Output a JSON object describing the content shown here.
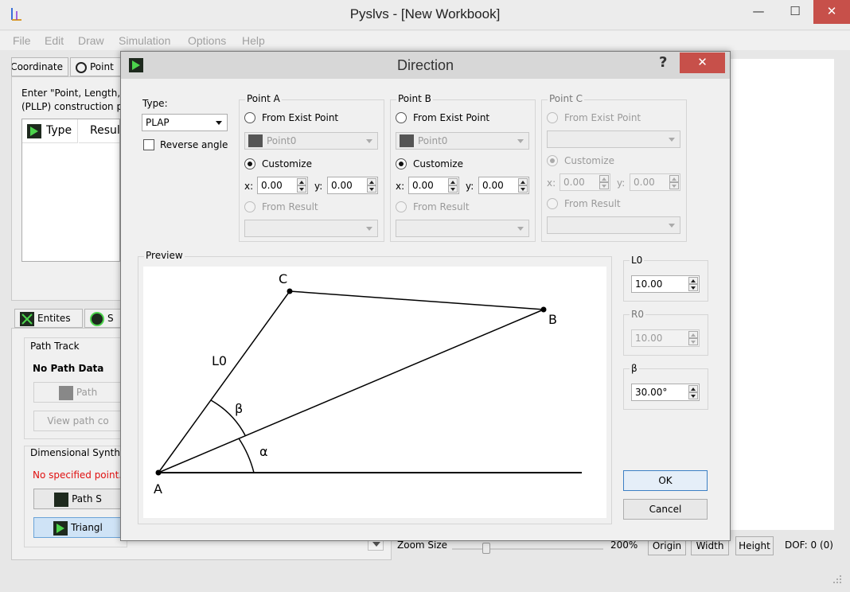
{
  "app": {
    "title": "Pyslvs - [New Workbook]"
  },
  "menu": [
    "File",
    "Edit",
    "Draw",
    "Simulation",
    "Options",
    "Help"
  ],
  "left_panel": {
    "tabs": [
      "Coordinate",
      "Point"
    ],
    "instruction_line1": "Enter \"Point, Length, A",
    "instruction_line2": "(PLLP) construction po",
    "table_headers": [
      "Type",
      "Result"
    ],
    "lower_tabs": [
      "Entites",
      "S"
    ],
    "path_track": {
      "title": "Path Track",
      "status": "No Path Data",
      "path_button": "Path",
      "view_button": "View path co"
    },
    "dimensional": {
      "title": "Dimensional Synthe",
      "error": "No specified point.",
      "path_button": "Path S",
      "triangle_button": "Triangl"
    }
  },
  "bottom_bar": {
    "zoom_label": "Zoom Size",
    "zoom_value": "200%",
    "buttons": [
      "Origin",
      "Width",
      "Height"
    ],
    "dof": "DOF: 0 (0)"
  },
  "dialog": {
    "title": "Direction",
    "help_icon": "?",
    "close_icon": "✕",
    "type_label": "Type:",
    "type_value": "PLAP",
    "reverse_angle": "Reverse angle",
    "point_a": {
      "title": "Point A",
      "from_exist": "From Exist Point",
      "exist_value": "Point0",
      "customize": "Customize",
      "x_label": "x:",
      "x_value": "0.00",
      "y_label": "y:",
      "y_value": "0.00",
      "from_result": "From Result"
    },
    "point_b": {
      "title": "Point B",
      "from_exist": "From Exist Point",
      "exist_value": "Point0",
      "customize": "Customize",
      "x_label": "x:",
      "x_value": "0.00",
      "y_label": "y:",
      "y_value": "0.00",
      "from_result": "From Result"
    },
    "point_c": {
      "title": "Point C",
      "from_exist": "From Exist Point",
      "customize": "Customize",
      "x_label": "x:",
      "x_value": "0.00",
      "y_label": "y:",
      "y_value": "0.00",
      "from_result": "From Result"
    },
    "preview": {
      "title": "Preview",
      "labels": {
        "a": "A",
        "b": "B",
        "c": "C",
        "l0": "L0",
        "beta": "β",
        "alpha": "α"
      }
    },
    "l0": {
      "label": "L0",
      "value": "10.00"
    },
    "r0": {
      "label": "R0",
      "value": "10.00"
    },
    "beta": {
      "label": "β",
      "value": "30.00°"
    },
    "ok": "OK",
    "cancel": "Cancel"
  }
}
